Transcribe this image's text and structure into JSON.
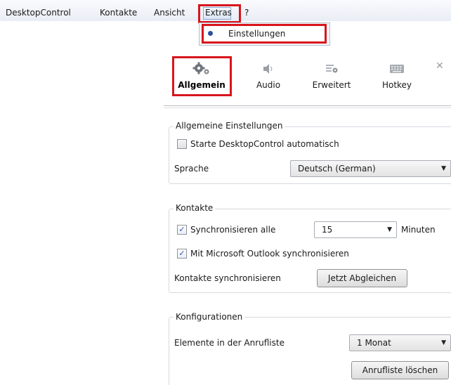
{
  "menubar": {
    "items": [
      "DesktopControl",
      "Kontakte",
      "Ansicht",
      "Extras",
      "?"
    ]
  },
  "extras_menu": {
    "items": [
      "Einstellungen"
    ]
  },
  "tabs": [
    {
      "label": "Allgemein",
      "icon": "gears-icon",
      "active": true
    },
    {
      "label": "Audio",
      "icon": "speaker-icon",
      "active": false
    },
    {
      "label": "Erweitert",
      "icon": "advanced-settings-icon",
      "active": false
    },
    {
      "label": "Hotkey",
      "icon": "keyboard-icon",
      "active": false
    }
  ],
  "general": {
    "title": "Allgemeine Einstellungen",
    "autostart_label": "Starte DesktopControl automatisch",
    "autostart_checked": false,
    "language_label": "Sprache",
    "language_value": "Deutsch (German)"
  },
  "contacts": {
    "title": "Kontakte",
    "sync_all_label": "Synchronisieren alle",
    "sync_all_checked": true,
    "sync_interval": "15",
    "sync_unit": "Minuten",
    "outlook_label": "Mit Microsoft Outlook synchronisieren",
    "outlook_checked": true,
    "sync_now_label": "Kontakte synchronisieren",
    "sync_now_button": "Jetzt Abgleichen"
  },
  "configurations": {
    "title": "Konfigurationen",
    "calllist_label": "Elemente in der Anrufliste",
    "calllist_value": "1 Monat",
    "clear_button": "Anrufliste löschen"
  },
  "colors": {
    "highlight": "#d8141c",
    "menubar": "#e9edf5"
  }
}
